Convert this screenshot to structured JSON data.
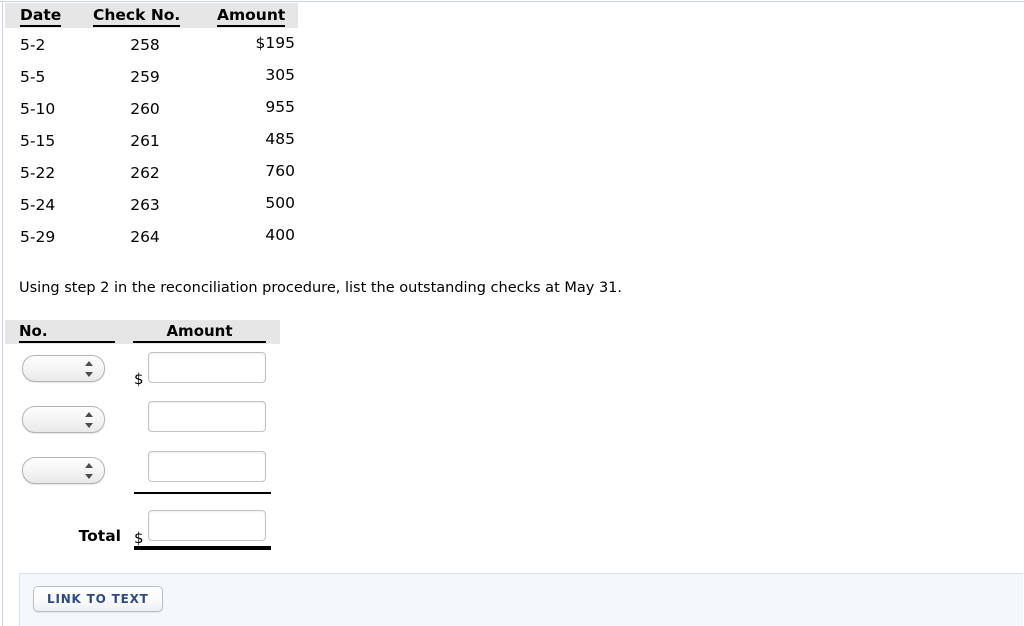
{
  "checks_table": {
    "headers": [
      "Date",
      "Check No.",
      "Amount"
    ],
    "rows": [
      {
        "date": "5-2",
        "check_no": "258",
        "amount": "$195"
      },
      {
        "date": "5-5",
        "check_no": "259",
        "amount": "305"
      },
      {
        "date": "5-10",
        "check_no": "260",
        "amount": "955"
      },
      {
        "date": "5-15",
        "check_no": "261",
        "amount": "485"
      },
      {
        "date": "5-22",
        "check_no": "262",
        "amount": "760"
      },
      {
        "date": "5-24",
        "check_no": "263",
        "amount": "500"
      },
      {
        "date": "5-29",
        "check_no": "264",
        "amount": "400"
      }
    ]
  },
  "instruction": "Using step 2 in the reconciliation procedure, list the outstanding checks at May 31.",
  "answer_table": {
    "headers": {
      "no": "No.",
      "amount": "Amount"
    },
    "currency_symbol": "$",
    "rows": [
      {
        "select_value": "",
        "amount_value": "",
        "amount_placeholder": ""
      },
      {
        "select_value": "",
        "amount_value": "",
        "amount_placeholder": ""
      },
      {
        "select_value": "",
        "amount_value": "",
        "amount_placeholder": ""
      }
    ],
    "select_options": [
      "",
      "258",
      "259",
      "260",
      "261",
      "262",
      "263",
      "264"
    ],
    "total_label": "Total",
    "total_value": "",
    "total_placeholder": ""
  },
  "footer": {
    "link_to_text_label": "LINK TO TEXT"
  },
  "colors": {
    "header_background": "#e6e6e6",
    "panel_background": "#f4f8fc",
    "panel_border": "#d5e0ec",
    "link_text": "#2b4a8b",
    "rule": "#c9d2e0"
  }
}
